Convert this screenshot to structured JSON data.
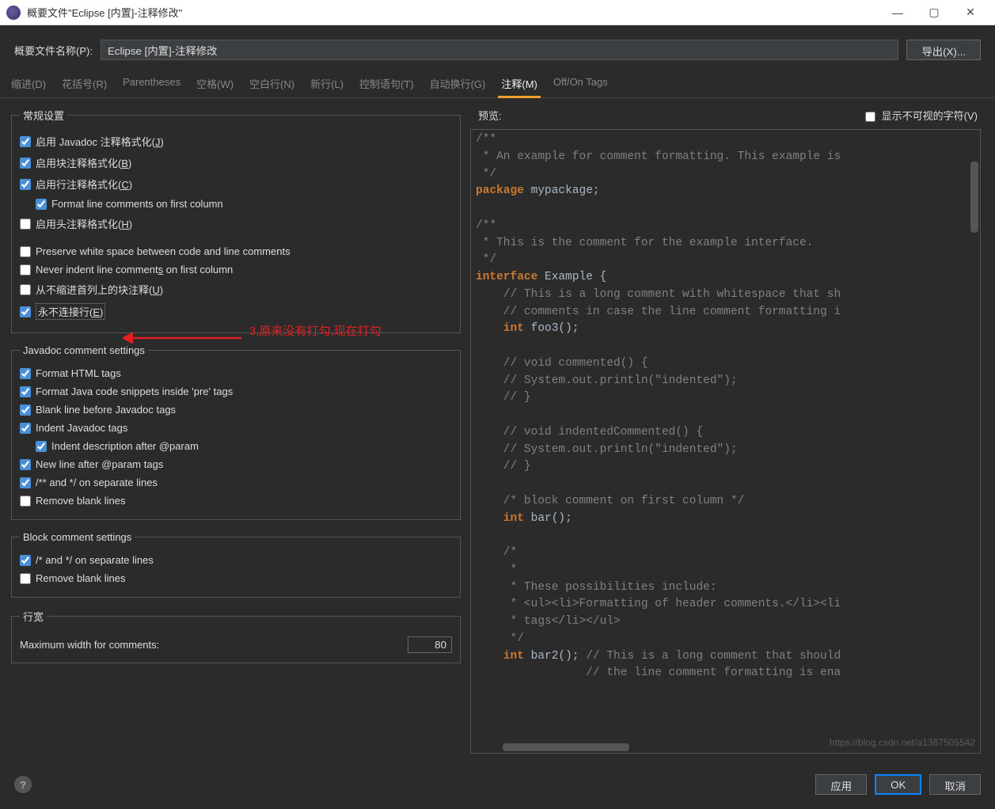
{
  "titlebar": {
    "title": "概要文件\"Eclipse [内置]-注释修改\""
  },
  "top": {
    "label": "概要文件名称(P):",
    "value": "Eclipse [内置]-注释修改",
    "export_btn": "导出(X)..."
  },
  "tabs": [
    "缩进(D)",
    "花括号(R)",
    "Parentheses",
    "空格(W)",
    "空白行(N)",
    "新行(L)",
    "控制语句(T)",
    "自动换行(G)",
    "注释(M)",
    "Off/On Tags"
  ],
  "active_tab": "注释(M)",
  "groups": {
    "general": {
      "legend": "常规设置",
      "items": [
        {
          "checked": true,
          "label_pre": "启用 Javadoc 注释格式化(",
          "u": "J",
          "label_post": ")"
        },
        {
          "checked": true,
          "label_pre": "启用块注释格式化(",
          "u": "B",
          "label_post": ")"
        },
        {
          "checked": true,
          "label_pre": "启用行注释格式化(",
          "u": "C",
          "label_post": ")"
        },
        {
          "checked": true,
          "indent": true,
          "label_pre": "Format line comments on first column",
          "u": "",
          "label_post": ""
        },
        {
          "checked": false,
          "label_pre": "启用头注释格式化(",
          "u": "H",
          "label_post": ")"
        },
        {
          "checked": false,
          "label_pre": "Preserve white space between code and line comments",
          "u": "",
          "label_post": ""
        },
        {
          "checked": false,
          "label_pre": "Never indent line comment",
          "u": "s",
          "label_post": " on first column"
        },
        {
          "checked": false,
          "label_pre": "从不缩进首列上的块注释(",
          "u": "U",
          "label_post": ")"
        },
        {
          "checked": true,
          "highlight": true,
          "label_pre": "永不连接行(",
          "u": "E",
          "label_post": ")"
        }
      ],
      "annotation": "3,原来没有打勾,现在打勾"
    },
    "javadoc": {
      "legend": "Javadoc comment settings",
      "items": [
        {
          "checked": true,
          "label": "Format HTML tags"
        },
        {
          "checked": true,
          "label": "Format Java code snippets inside 'pre' tags"
        },
        {
          "checked": true,
          "label": "Blank line before Javadoc tags"
        },
        {
          "checked": true,
          "label": "Indent Javadoc tags"
        },
        {
          "checked": true,
          "indent": true,
          "label": "Indent description after @param"
        },
        {
          "checked": true,
          "label": "New line after @param tags"
        },
        {
          "checked": true,
          "label": "/** and */ on separate lines"
        },
        {
          "checked": false,
          "label": "Remove blank lines"
        }
      ]
    },
    "block": {
      "legend": "Block comment settings",
      "items": [
        {
          "checked": true,
          "label": "/* and */ on separate lines"
        },
        {
          "checked": false,
          "label": "Remove blank lines"
        }
      ]
    },
    "linewidth": {
      "legend": "行宽",
      "label": "Maximum width for comments:",
      "value": "80"
    }
  },
  "preview": {
    "label": "预览:",
    "show_invisible": "显示不可视的字符(V)",
    "show_invisible_checked": false
  },
  "footer": {
    "apply": "应用",
    "ok": "OK",
    "cancel": "取消"
  },
  "watermark": "https://blog.csdn.net/a1367505542",
  "code": {
    "l1": "/**",
    "l2": " * An example for comment formatting. This example is",
    "l3": " */",
    "l4a": "package",
    "l4b": " mypackage;",
    "l5": "/**",
    "l6": " * This is the comment for the example interface.",
    "l7": " */",
    "l8a": "interface",
    "l8b": " Example {",
    "l9": "    // This is a long comment with whitespace that sh",
    "l10": "    // comments in case the line comment formatting i",
    "l11a": "    int",
    "l11b": " foo3();",
    "l12": "    // void commented() {",
    "l13": "    // System.out.println(\"indented\");",
    "l14": "    // }",
    "l15": "    // void indentedCommented() {",
    "l16": "    // System.out.println(\"indented\");",
    "l17": "    // }",
    "l18": "    /* block comment on first column */",
    "l19a": "    int",
    "l19b": " bar();",
    "l20": "    /*",
    "l21": "     *",
    "l22": "     * These possibilities include:",
    "l23": "     * <ul><li>Formatting of header comments.</li><li",
    "l24": "     * tags</li></ul>",
    "l25": "     */",
    "l26a": "    int",
    "l26b": " bar2(); ",
    "l26c": "// This is a long comment that should",
    "l27": "                // the line comment formatting is ena"
  }
}
